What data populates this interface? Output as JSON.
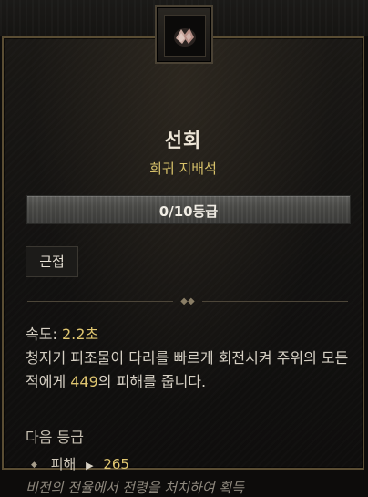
{
  "item": {
    "title": "선회",
    "subtitle": "희귀 지배석",
    "rank": "0/10등급",
    "tag": "근접",
    "speed_label": "속도:",
    "speed_value": "2.2초",
    "description_part1": "청지기 피조물이 다리를 빠르게 회전시켜 주위의 모든 적에게 ",
    "description_damage": "449",
    "description_part2": "의 피해를 줍니다.",
    "next_rank_label": "다음 등급",
    "next_rank_stat_label": "피해",
    "next_rank_stat_value": "265",
    "source_text": "비전의 전율에서 전령을 처치하여 획득"
  },
  "colors": {
    "gold": "#e0c670",
    "rare_yellow": "#d8c26a",
    "frame": "#5a4d33"
  },
  "icons": [
    "crystal-icon",
    "divider-ornament-icon",
    "diamond-bullet-icon",
    "arrow-right-icon"
  ]
}
